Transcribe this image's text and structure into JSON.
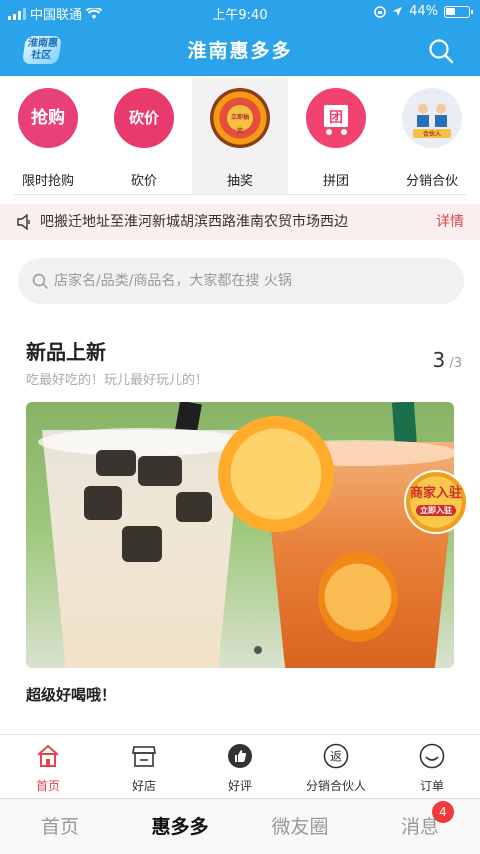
{
  "status_bar": {
    "carrier": "中国联通",
    "time": "上午9:40",
    "battery": "44%",
    "battery_level": 0.44
  },
  "header": {
    "logo_text": "淮南惠社区",
    "title": "淮南惠多多"
  },
  "categories": [
    {
      "label": "限时抢购",
      "icon_text": "抢购"
    },
    {
      "label": "砍价",
      "icon_text": "砍价"
    },
    {
      "label": "抽奖",
      "icon_text": "立即抽奖"
    },
    {
      "label": "拼团",
      "icon_text": "团"
    },
    {
      "label": "分销合伙",
      "icon_text": "合伙人"
    }
  ],
  "notice": {
    "text": "吧搬迁地址至淮河新城胡滨西路淮南农贸市场西边",
    "detail": "详情"
  },
  "search": {
    "placeholder": "店家名/品类/商品名，大家都在搜 火锅"
  },
  "section": {
    "title": "新品上新",
    "subtitle": "吃最好吃的！玩儿最好玩儿的！",
    "page_current": "3",
    "page_total": "/3"
  },
  "banner": {
    "caption": "超级好喝哦！"
  },
  "floating_badge": {
    "text": "商家入驻",
    "sub": "立即入驻"
  },
  "inner_tabs": [
    {
      "label": "首页"
    },
    {
      "label": "好店"
    },
    {
      "label": "好评"
    },
    {
      "label": "分销合伙人",
      "icon_text": "返"
    },
    {
      "label": "订单"
    }
  ],
  "outer_nav": [
    {
      "label": "首页"
    },
    {
      "label": "惠多多"
    },
    {
      "label": "微友圈"
    },
    {
      "label": "消息",
      "badge": "4"
    }
  ],
  "colors": {
    "header": "#2aa3ea",
    "accent": "#e0444d",
    "notice_bg": "#fbeeee"
  }
}
